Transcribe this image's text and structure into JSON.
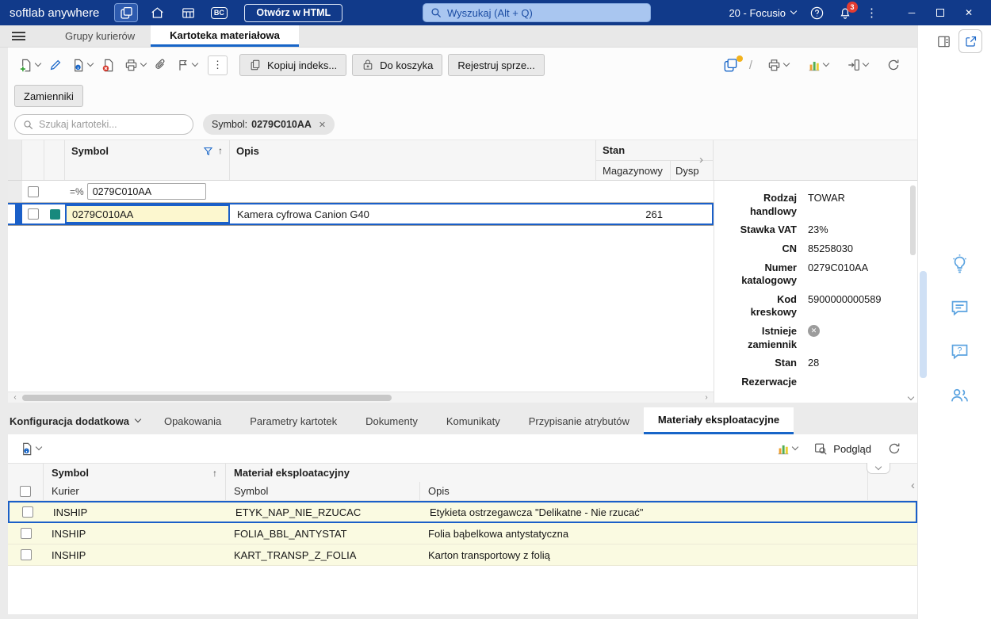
{
  "topbar": {
    "logo": "softlab anywhere",
    "open_html_label": "Otwórz w HTML",
    "search_placeholder": "Wyszukaj (Alt + Q)",
    "profile_label": "20 - Focusio",
    "badge_count": "3"
  },
  "tab_bar": {
    "tab_couriers": "Grupy kurierów",
    "tab_kartoteka": "Kartoteka materiałowa"
  },
  "toolbar": {
    "copy_index_label": "Kopiuj indeks...",
    "basket_label": "Do koszyka",
    "register_label": "Rejestruj sprze...",
    "substitutes_label": "Zamienniki"
  },
  "filter_bar": {
    "search_placeholder": "Szukaj kartoteki...",
    "chip_prefix": "Symbol:",
    "chip_value": "0279C010AA"
  },
  "grid": {
    "header": {
      "symbol": "Symbol",
      "opis": "Opis",
      "stan": "Stan",
      "magazynowy": "Magazynowy",
      "dysp": "Dysp"
    },
    "filter_operator": "=%",
    "filter_value": "0279C010AA",
    "row": {
      "symbol": "0279C010AA",
      "opis": "Kamera cyfrowa Canion G40",
      "magazynowy": "261"
    }
  },
  "details": {
    "fields": [
      {
        "label": "Rodzaj handlowy",
        "value": "TOWAR"
      },
      {
        "label": "Stawka VAT",
        "value": "23%"
      },
      {
        "label": "CN",
        "value": "85258030"
      },
      {
        "label": "Numer katalogowy",
        "value": "0279C010AA"
      },
      {
        "label": "Kod kreskowy",
        "value": "5900000000589"
      },
      {
        "label": "Istnieje zamiennik",
        "value": ""
      },
      {
        "label": "Stan",
        "value": "28"
      },
      {
        "label": "Rezerwacje",
        "value": ""
      }
    ]
  },
  "bottom_tabs": {
    "config_label": "Konfiguracja dodatkowa",
    "tabs": [
      "Opakowania",
      "Parametry kartotek",
      "Dokumenty",
      "Komunikaty",
      "Przypisanie atrybutów",
      "Materiały eksploatacyjne"
    ]
  },
  "bottom_toolbar": {
    "preview_label": "Podgląd"
  },
  "materials_grid": {
    "group_symbol": "Symbol",
    "group_material": "Materiał eksploatacyjny",
    "col_kurier": "Kurier",
    "col_symbol": "Symbol",
    "col_opis": "Opis",
    "rows": [
      {
        "kurier": "INSHIP",
        "symbol": "ETYK_NAP_NIE_RZUCAC",
        "opis": "Etykieta ostrzegawcza \"Delikatne - Nie rzucać\""
      },
      {
        "kurier": "INSHIP",
        "symbol": "FOLIA_BBL_ANTYSTAT",
        "opis": "Folia bąbelkowa antystatyczna"
      },
      {
        "kurier": "INSHIP",
        "symbol": "KART_TRANSP_Z_FOLIA",
        "opis": "Karton transportowy z folią"
      }
    ]
  }
}
